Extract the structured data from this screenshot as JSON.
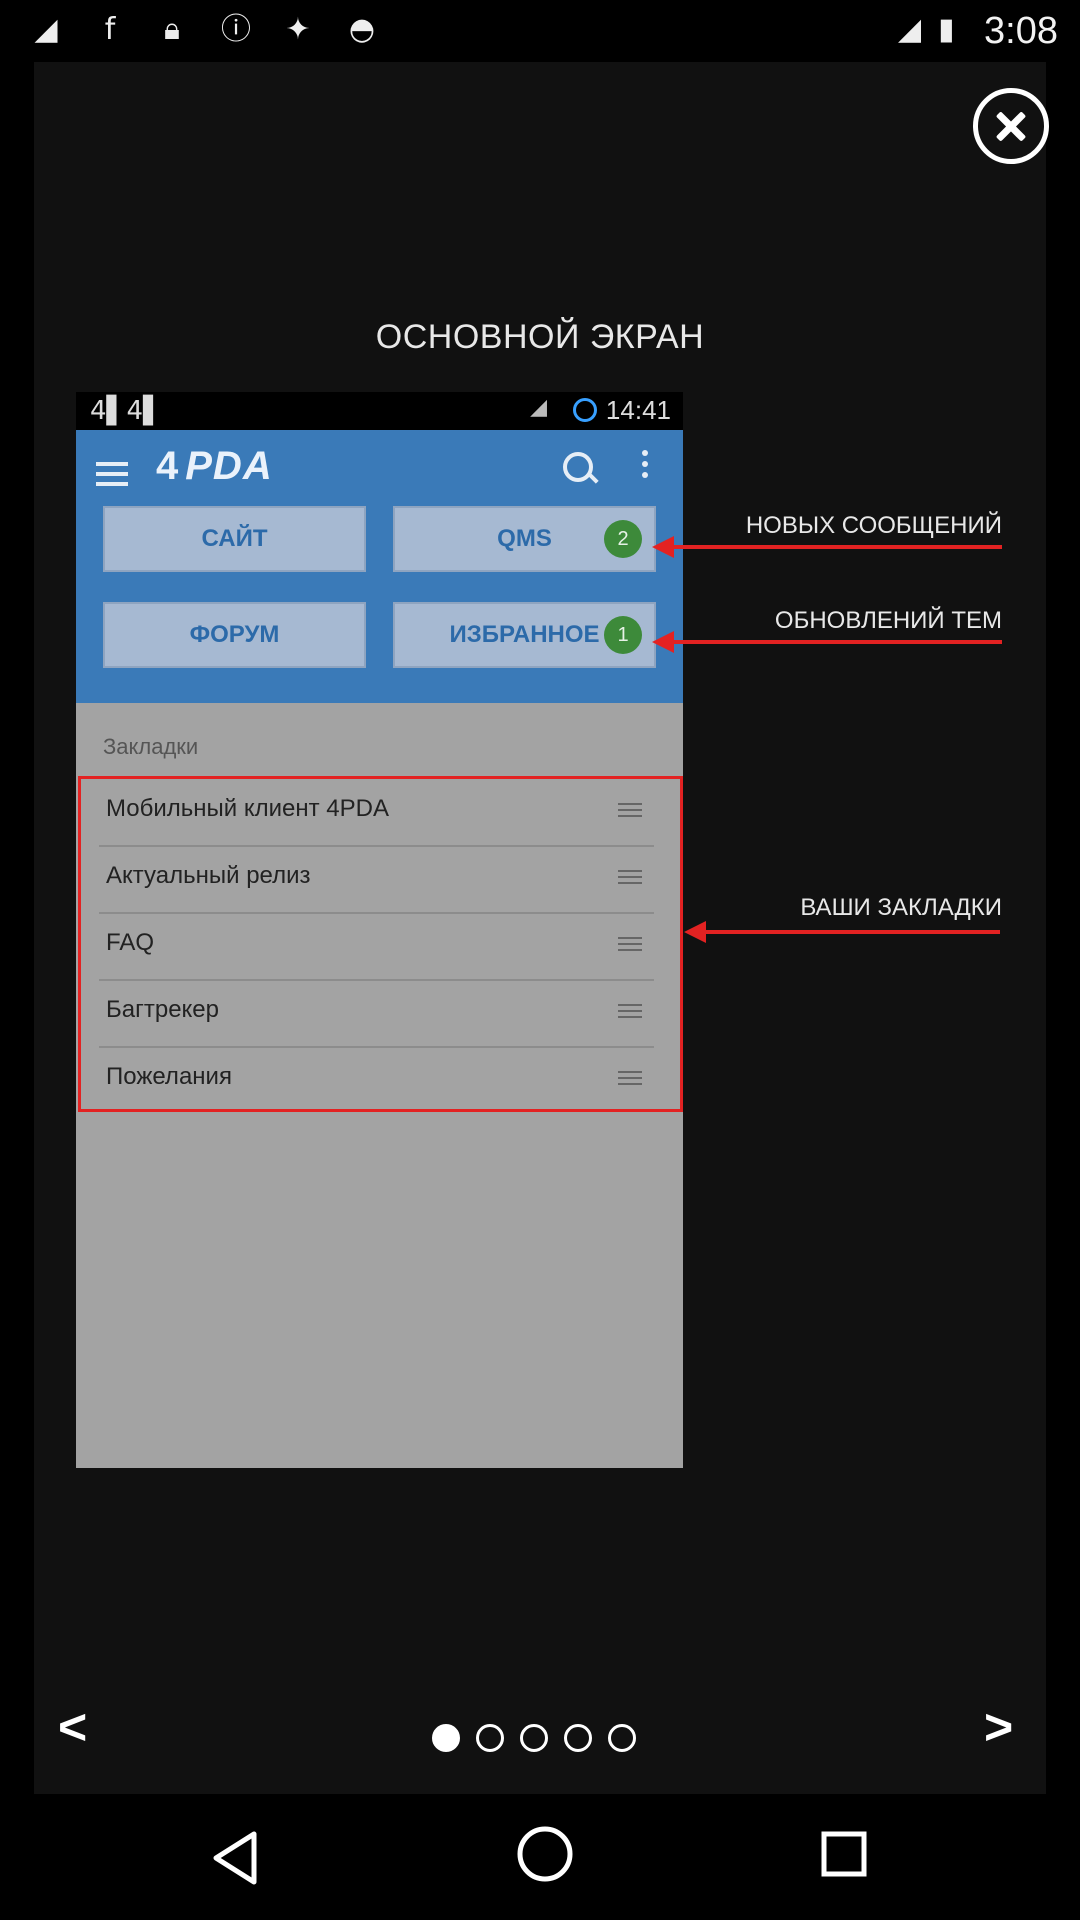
{
  "status_bar": {
    "time": "3:08",
    "icons": [
      "signal-icon",
      "facebook-icon",
      "lock-icon",
      "info-icon",
      "satellite-icon",
      "android-icon"
    ]
  },
  "overlay": {
    "title": "ОСНОВНОЙ ЭКРАН",
    "annotations": {
      "new_messages": "НОВЫХ СООБЩЕНИЙ",
      "topic_updates": "ОБНОВЛЕНИЙ ТЕМ",
      "your_bookmarks": "ВАШИ ЗАКЛАДКИ"
    },
    "pager": {
      "prev": "<",
      "next": ">",
      "pages": 5,
      "current": 1
    }
  },
  "inner_phone": {
    "status": {
      "left_icons": "4▌4▌",
      "time": "14:41"
    },
    "header": {
      "logo": "PDA",
      "logo_mark": "4"
    },
    "buttons": {
      "site": "САЙТ",
      "qms": "QMS",
      "qms_badge": "2",
      "forum": "ФОРУМ",
      "favorites": "ИЗБРАННОЕ",
      "favorites_badge": "1"
    },
    "bookmarks_header": "Закладки",
    "bookmarks": [
      {
        "label": "Мобильный клиент 4PDA"
      },
      {
        "label": "Актуальный релиз"
      },
      {
        "label": "FAQ"
      },
      {
        "label": "Багтрекер"
      },
      {
        "label": "Пожелания"
      }
    ]
  },
  "colors": {
    "header_blue": "#3a7ab8",
    "annotation_red": "#e32222",
    "badge_green": "#3d8a3a"
  }
}
